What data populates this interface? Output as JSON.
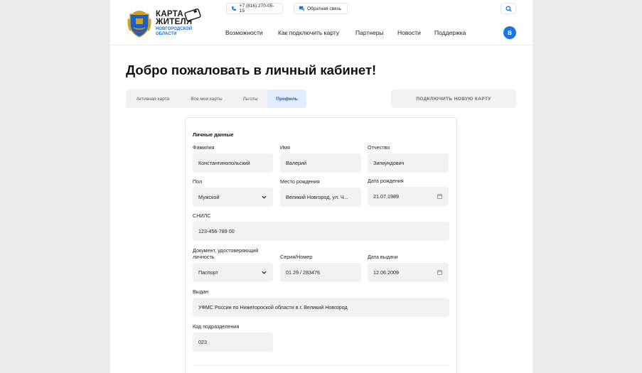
{
  "header": {
    "logo": {
      "line1": "КАРТА",
      "line2": "ЖИТЕЛЯ",
      "line3": "НОВГОРОДСКОЙ",
      "line4": "ОБЛАСТИ"
    },
    "phone": "+7 (816) 270-05-15",
    "feedback": "Обратная связь",
    "nav": [
      "Возможности",
      "Как подключить карту",
      "Партнеры",
      "Новости",
      "Поддержка"
    ],
    "avatar_letter": "В"
  },
  "welcome": "Добро пожаловать в личный кабинет!",
  "tabs": [
    {
      "label": "Активная карта",
      "active": false
    },
    {
      "label": "Все мои карты",
      "active": false
    },
    {
      "label": "Льготы",
      "active": false
    },
    {
      "label": "Профиль",
      "active": true
    }
  ],
  "connect_button": "ПОДКЛЮЧИТЬ НОВУЮ КАРТУ",
  "profile": {
    "section_title": "Личные данные",
    "last_name": {
      "label": "Фамилия",
      "value": "Константинопольский"
    },
    "first_name": {
      "label": "Имя",
      "value": "Валерий"
    },
    "patronymic": {
      "label": "Отчество",
      "value": "Зигмундович"
    },
    "gender": {
      "label": "Пол",
      "value": "Мужской"
    },
    "birth_place": {
      "label": "Место рождения",
      "value": "Великий Новгород, ул. Ч..."
    },
    "birth_date": {
      "label": "Дата рождения",
      "value": "21.07.1989"
    },
    "snils": {
      "label": "СНИЛС",
      "value": "123-456-789 00"
    },
    "doc_type": {
      "label_line1": "Документ, удостоверяющий",
      "label_line2": "личность",
      "value": "Паспорт"
    },
    "series_number": {
      "label": "Серия/Номер",
      "value": "01 29 / 283476"
    },
    "issue_date": {
      "label": "Дата выдачи",
      "value": "12.06.2009"
    },
    "issued_by": {
      "label": "Выдан",
      "value": "УФМС России по Нижегороской области в г. Великий Новгород"
    },
    "dept_code": {
      "label": "Код подразделения",
      "value": "023"
    }
  },
  "colors": {
    "accent": "#1a73e8",
    "field_bg": "#f2f2f3",
    "page_bg": "#ebebed"
  }
}
